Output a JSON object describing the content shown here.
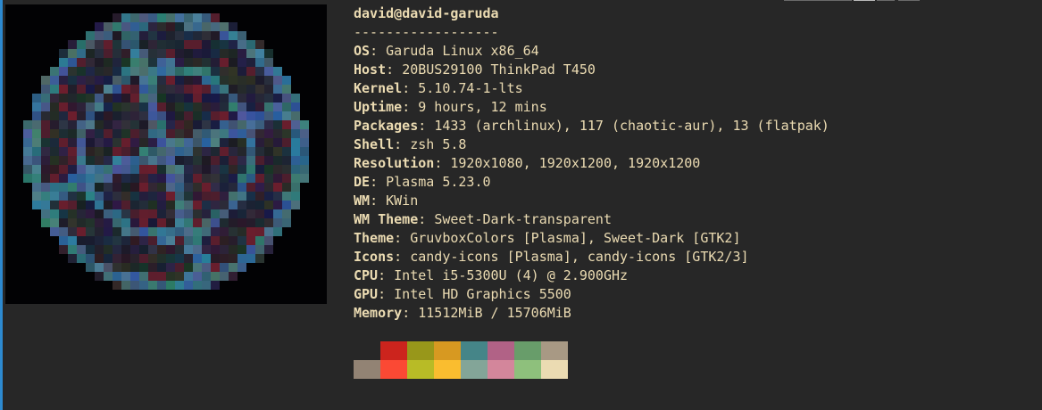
{
  "window": {
    "accent_color": "#2d8ad0",
    "background": "#272727"
  },
  "header": {
    "user": "david",
    "at": "@",
    "host": "david-garuda",
    "divider": "------------------"
  },
  "info": [
    {
      "key": "OS",
      "value": "Garuda Linux x86_64"
    },
    {
      "key": "Host",
      "value": "20BUS29100 ThinkPad T450"
    },
    {
      "key": "Kernel",
      "value": "5.10.74-1-lts"
    },
    {
      "key": "Uptime",
      "value": "9 hours, 12 mins"
    },
    {
      "key": "Packages",
      "value": "1433 (archlinux), 117 (chaotic-aur), 13 (flatpak)"
    },
    {
      "key": "Shell",
      "value": "zsh 5.8"
    },
    {
      "key": "Resolution",
      "value": "1920x1080, 1920x1200, 1920x1200"
    },
    {
      "key": "DE",
      "value": "Plasma 5.23.0"
    },
    {
      "key": "WM",
      "value": "KWin"
    },
    {
      "key": "WM Theme",
      "value": "Sweet-Dark-transparent"
    },
    {
      "key": "Theme",
      "value": "GruvboxColors [Plasma], Sweet-Dark [GTK2]"
    },
    {
      "key": "Icons",
      "value": "candy-icons [Plasma], candy-icons [GTK2/3]"
    },
    {
      "key": "CPU",
      "value": "Intel i5-5300U (4) @ 2.900GHz"
    },
    {
      "key": "GPU",
      "value": "Intel HD Graphics 5500"
    },
    {
      "key": "Memory",
      "value": "11512MiB / 15706MiB"
    }
  ],
  "separator": ": ",
  "palette": {
    "row1": [
      "#272727",
      "#cc241d",
      "#98971a",
      "#d79921",
      "#458588",
      "#b16286",
      "#689d6a",
      "#a89984"
    ],
    "row2": [
      "#928374",
      "#fb4934",
      "#b8bb26",
      "#fabd2f",
      "#83a598",
      "#d3869b",
      "#8ec07c",
      "#ebdbb2"
    ]
  },
  "logo": {
    "name": "garuda-logo-image"
  }
}
